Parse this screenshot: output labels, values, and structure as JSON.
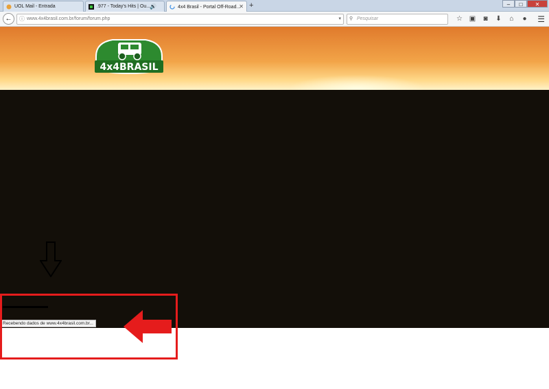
{
  "tabs": [
    {
      "title": "UOL Mail - Entrada",
      "active": false
    },
    {
      "title": ".977 - Today's Hits | Ou...",
      "active": false
    },
    {
      "title": "4x4 Brasil - Portal Off-Road...",
      "active": true
    }
  ],
  "new_tab_label": "+",
  "window_controls": {
    "minimize": "–",
    "maximize": "□",
    "close": "✕"
  },
  "url": "www.4x4brasil.com.br/forum/forum.php",
  "search_placeholder": "Pesquisar",
  "logo_text": "4x4BRASIL",
  "status_text": "Recebendo dados de www.4x4brasil.com.br...",
  "colors": {
    "annotation_red": "#e51c1c",
    "page_dark": "#130f09"
  }
}
